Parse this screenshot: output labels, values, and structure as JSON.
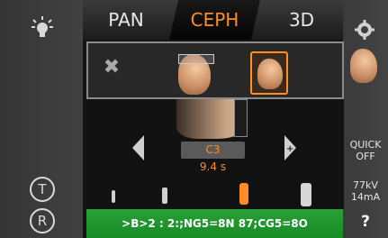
{
  "tabs": [
    {
      "label": "PAN",
      "active": false
    },
    {
      "label": "CEPH",
      "active": true
    },
    {
      "label": "3D",
      "active": false
    }
  ],
  "colors": {
    "accent": "#ff8c24",
    "status_bg": "#1f9a2e"
  },
  "left_panel": {
    "light_icon": "light-bulb-icon",
    "t_button": "T",
    "r_button": "R"
  },
  "right_panel": {
    "settings_icon": "gear-icon",
    "quick_line1": "QUICK",
    "quick_line2": "OFF",
    "kv": "77kV",
    "ma": "14mA",
    "help": "?"
  },
  "selector": {
    "label": "C3",
    "time": "9.4 s"
  },
  "status_text": ">B>2 : 2:;NG5=8N 87;CG5=8O"
}
